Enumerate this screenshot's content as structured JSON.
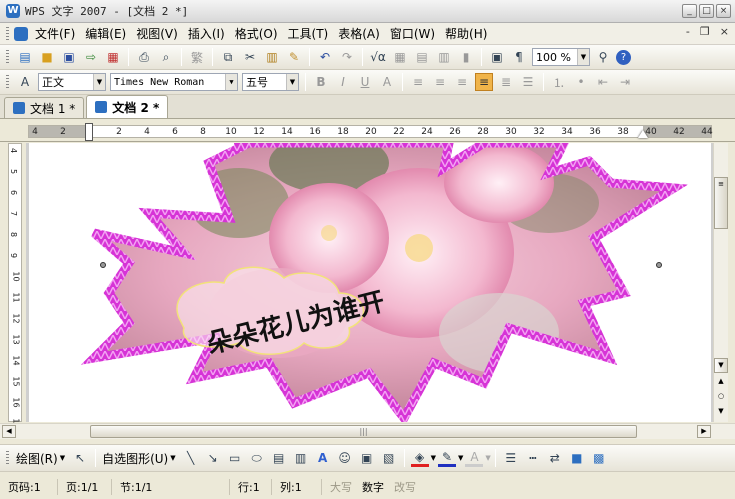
{
  "window": {
    "title": "WPS 文字 2007 - [文档 2 *]",
    "controls": [
      "_",
      "□",
      "×"
    ]
  },
  "menubar": {
    "items": [
      "文件(F)",
      "编辑(E)",
      "视图(V)",
      "插入(I)",
      "格式(O)",
      "工具(T)",
      "表格(A)",
      "窗口(W)",
      "帮助(H)"
    ],
    "mdi_controls": [
      "-",
      "❐",
      "×"
    ]
  },
  "toolbar": {
    "zoom": "100 %"
  },
  "format_bar": {
    "style": "正文",
    "font": "Times New Roman",
    "size": "五号"
  },
  "tabs": [
    {
      "label": "文档 1 *",
      "active": false
    },
    {
      "label": "文档 2 *",
      "active": true
    }
  ],
  "ruler": {
    "h_ticks": [
      "4",
      "2",
      "",
      "2",
      "4",
      "6",
      "8",
      "10",
      "12",
      "14",
      "16",
      "18",
      "20",
      "22",
      "24",
      "26",
      "28",
      "30",
      "32",
      "34",
      "36",
      "38",
      "40",
      "42",
      "44"
    ],
    "v_ticks": [
      "4",
      "5",
      "6",
      "7",
      "8",
      "9",
      "10",
      "11",
      "12",
      "13",
      "14",
      "15",
      "16",
      "17"
    ]
  },
  "document": {
    "wordart": "朵朵花儿为谁开",
    "shape": "star-explosion",
    "border_color": "#d633d6",
    "fill": "pink cherry blossom photo"
  },
  "drawing_bar": {
    "draw_label": "绘图(R)",
    "autoshape_label": "自选图形(U)"
  },
  "status": {
    "page_code": "页码:1",
    "page": "页:1/1",
    "section": "节:1/1",
    "line": "行:1",
    "col": "列:1",
    "caps": "大写",
    "num": "数字",
    "ovr": "改写"
  },
  "colors": {
    "accent": "#f0b44a",
    "star_border": "#d633d6",
    "font_color": "#e02020",
    "line_color": "#2030c0"
  }
}
